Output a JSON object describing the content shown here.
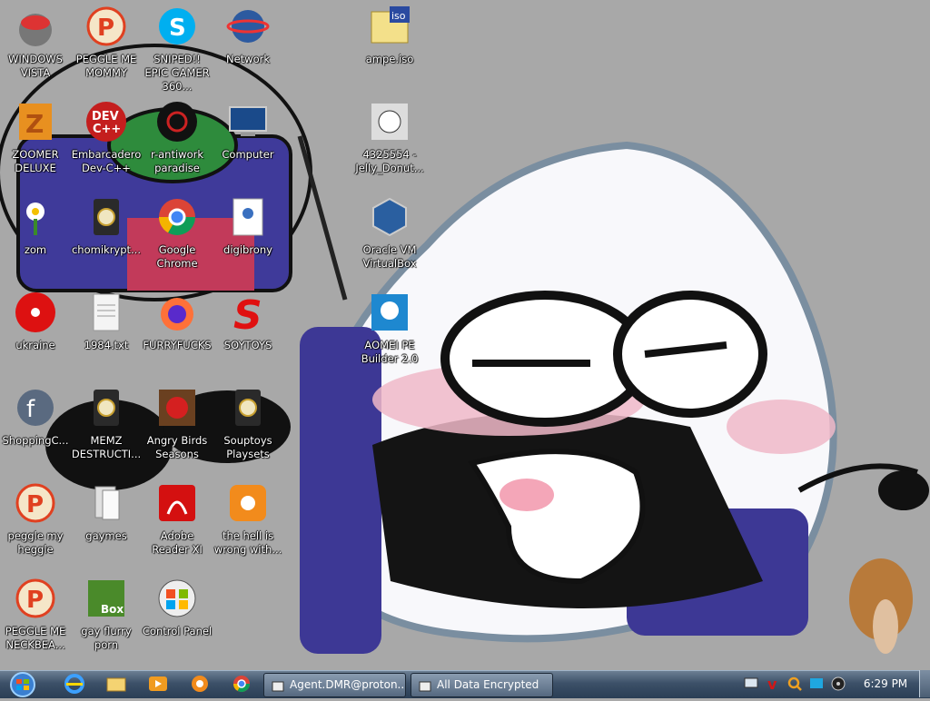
{
  "desktop": {
    "icons": [
      {
        "name": "windows-vista-icon",
        "label": "WINDOWS VISTA"
      },
      {
        "name": "peggle-me-mommy-icon",
        "label": "PEGGLE ME MOMMY"
      },
      {
        "name": "skype-icon",
        "label": "SNIPED!! EPIC GAMER 360..."
      },
      {
        "name": "network-icon",
        "label": "Network"
      },
      {
        "name": "iso-file-icon",
        "label": "ampe.iso"
      },
      {
        "name": "zoomer-deluxe-icon",
        "label": "ZOOMER DELUXE"
      },
      {
        "name": "dev-cpp-icon",
        "label": "Embarcadero Dev-C++"
      },
      {
        "name": "r-antiwork-icon",
        "label": "r-antiwork paradise"
      },
      {
        "name": "computer-icon",
        "label": "Computer"
      },
      {
        "name": "jelly-donut-icon",
        "label": "4325554 - Jelly_Donut..."
      },
      {
        "name": "zom-flower-icon",
        "label": "zom"
      },
      {
        "name": "chomikrypt-icon",
        "label": "chomikrypt..."
      },
      {
        "name": "google-chrome-icon",
        "label": "Google Chrome"
      },
      {
        "name": "digibrony-icon",
        "label": "digibrony"
      },
      {
        "name": "virtualbox-icon",
        "label": "Oracle VM VirtualBox"
      },
      {
        "name": "radiation-icon",
        "label": "ukraine"
      },
      {
        "name": "text-file-icon",
        "label": "1984.txt"
      },
      {
        "name": "firefox-icon",
        "label": "FURRYFUCKS"
      },
      {
        "name": "soytoys-icon",
        "label": "SOYTOYS"
      },
      {
        "name": "aomei-icon",
        "label": "AOMEI PE Builder 2.0"
      },
      {
        "name": "shockwave-icon",
        "label": "ShoppingC..."
      },
      {
        "name": "memz-icon",
        "label": "MEMZ DESTRUCTI..."
      },
      {
        "name": "angry-birds-icon",
        "label": "Angry Birds Seasons"
      },
      {
        "name": "souptoys-icon",
        "label": "Souptoys Playsets"
      },
      {
        "name": "peggle-my-heggle-icon",
        "label": "peggle my heggle"
      },
      {
        "name": "gaymes-icon",
        "label": "gaymes"
      },
      {
        "name": "adobe-reader-icon",
        "label": "Adobe Reader XI"
      },
      {
        "name": "uc-browser-icon",
        "label": "the hell is wrong with..."
      },
      {
        "name": "peggle-neckbeard-icon",
        "label": "PEGGLE ME NECKBEA..."
      },
      {
        "name": "gay-fluffy-porn-icon",
        "label": "gay flurry porn"
      },
      {
        "name": "control-panel-icon",
        "label": "Control Panel"
      }
    ]
  },
  "taskbar": {
    "quicklaunch": [
      "internet-explorer-icon",
      "explorer-folder-icon",
      "media-player-icon",
      "uc-browser-taskbar-icon",
      "chrome-taskbar-icon"
    ],
    "buttons": [
      {
        "label": "Agent.DMR@proton..."
      },
      {
        "label": "All Data Encrypted"
      }
    ],
    "clock": "6:29 PM"
  }
}
